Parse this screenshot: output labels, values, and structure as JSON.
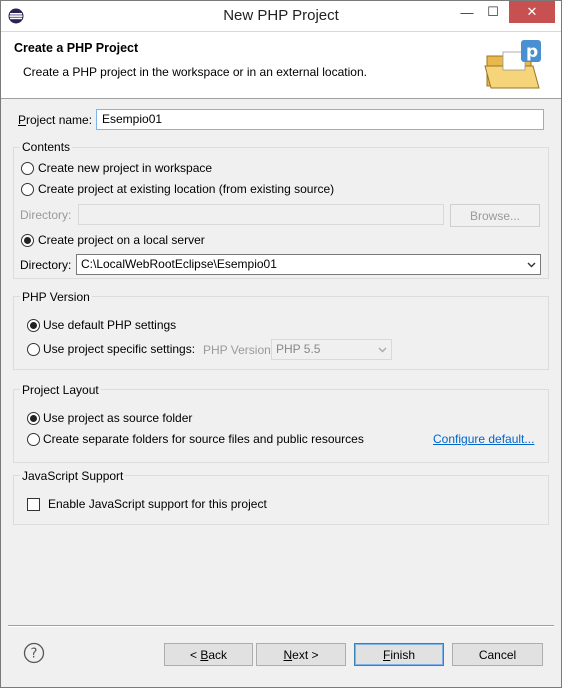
{
  "window": {
    "title": "New PHP Project",
    "minimize_glyph": "—",
    "maximize_glyph": "☐",
    "close_glyph": "✕"
  },
  "header": {
    "title": "Create a PHP Project",
    "description": "Create a PHP project in the workspace or in an external location.",
    "icon": "php-project-folder-icon"
  },
  "project_name": {
    "label": "Project name:",
    "value": "Esempio01"
  },
  "contents": {
    "title": "Contents",
    "option_new_workspace": "Create new project in workspace",
    "option_existing_location": "Create project at existing location (from existing source)",
    "directory_label": "Directory:",
    "directory_value": "",
    "browse_label": "Browse...",
    "option_local_server": "Create project on a local server",
    "server_directory_label": "Directory:",
    "server_directory_value": "C:\\LocalWebRootEclipse\\Esempio01",
    "selected": "local_server"
  },
  "php_version": {
    "title": "PHP Version",
    "option_default": "Use default PHP settings",
    "option_specific": "Use project specific settings:",
    "version_label": "PHP Version:",
    "version_value": "PHP 5.5",
    "selected": "default"
  },
  "project_layout": {
    "title": "Project Layout",
    "option_source_folder": "Use project as source folder",
    "option_separate_folders": "Create separate folders for source files and public resources",
    "configure_link": "Configure default...",
    "selected": "source_folder"
  },
  "javascript": {
    "title": "JavaScript Support",
    "enable_label": "Enable JavaScript support for this project",
    "enabled": false
  },
  "footer": {
    "help_glyph": "?",
    "back_label": "< Back",
    "next_label": "Next >",
    "finish_label": "Finish",
    "cancel_label": "Cancel"
  },
  "colors": {
    "panel_bg": "#f0f0f0",
    "focus_border": "#7eb4ea",
    "link": "#0066cc",
    "close_button": "#c75050"
  }
}
